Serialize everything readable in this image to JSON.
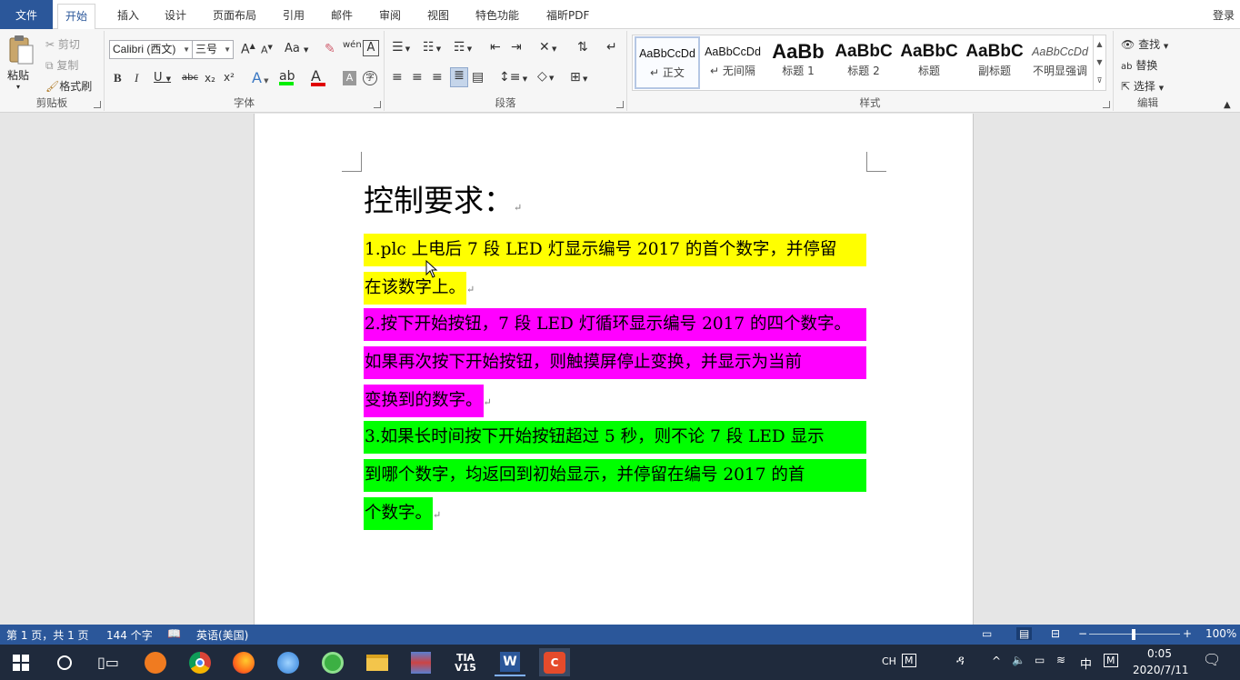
{
  "tabs": [
    "文件",
    "开始",
    "插入",
    "设计",
    "页面布局",
    "引用",
    "邮件",
    "审阅",
    "视图",
    "特色功能",
    "福昕PDF"
  ],
  "login": "登录",
  "clipboard": {
    "paste": "粘贴",
    "cut": "剪切",
    "copy": "复制",
    "format_painter": "格式刷",
    "label": "剪贴板"
  },
  "font": {
    "name": "Calibri (西文)",
    "size": "三号",
    "label": "字体",
    "grow": "A",
    "shrink": "A",
    "case": "Aa",
    "bold": "B",
    "italic": "I",
    "underline": "U",
    "strike": "abc",
    "sub": "x₂",
    "sup": "x²"
  },
  "paragraph": {
    "label": "段落"
  },
  "styles": {
    "label": "样式",
    "items": [
      {
        "sample": "AaBbCcDd",
        "name": "正文"
      },
      {
        "sample": "AaBbCcDd",
        "name": "无间隔"
      },
      {
        "sample": "AaBb",
        "name": "标题 1"
      },
      {
        "sample": "AaBbC",
        "name": "标题 2"
      },
      {
        "sample": "AaBbC",
        "name": "标题"
      },
      {
        "sample": "AaBbC",
        "name": "副标题"
      },
      {
        "sample": "AaBbCcDd",
        "name": "不明显强调"
      }
    ]
  },
  "editing": {
    "find": "查找",
    "replace": "替换",
    "select": "选择",
    "label": "编辑"
  },
  "document": {
    "title": "控制要求：",
    "paragraphs": [
      {
        "color": "#ffff00",
        "lines": [
          "1.plc 上电后 7 段 LED 灯显示编号 2017 的首个数字，并停留",
          "在该数字上。"
        ]
      },
      {
        "color": "#ff00ff",
        "lines": [
          "2.按下开始按钮，7 段 LED 灯循环显示编号 2017 的四个数字。",
          "如果再次按下开始按钮，则触摸屏停止变换，并显示为当前",
          "变换到的数字。"
        ]
      },
      {
        "color": "#00ff00",
        "lines": [
          "3.如果长时间按下开始按钮超过 5 秒，则不论 7 段 LED 显示",
          "到哪个数字，均返回到初始显示，并停留在编号 2017 的首",
          "个数字。"
        ]
      }
    ]
  },
  "status": {
    "page": "第 1 页，共 1 页",
    "words": "144 个字",
    "lang": "英语(美国)",
    "zoom": "100%"
  },
  "taskbar": {
    "time": "0:05",
    "date": "2020/7/11",
    "ime": "中",
    "ime2": "M",
    "ch": "CH"
  }
}
